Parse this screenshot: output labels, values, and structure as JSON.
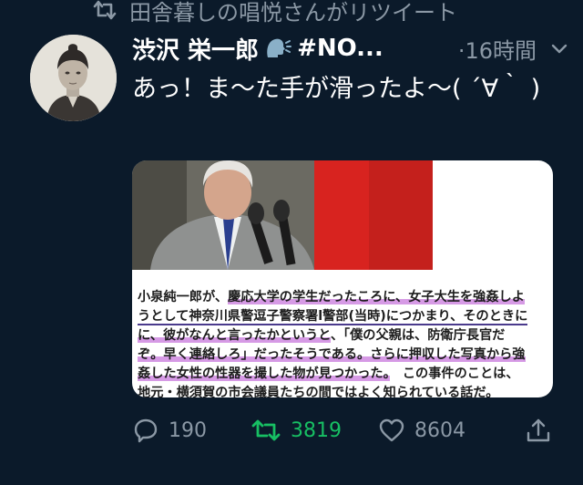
{
  "retweet_banner": {
    "text": "田舎暮しの唱悦さんがリツイート",
    "icon": "retweet-icon"
  },
  "tweet": {
    "author_name": "渋沢 栄一郎",
    "name_emoji": "speaking-head-icon",
    "name_suffix": "#NO...",
    "time": "·16時間",
    "text": "あっ！ま〜た手が滑ったよ〜( ´∀｀ )",
    "media": {
      "caption_lines": [
        {
          "segments": [
            {
              "t": "小泉純一郎が、",
              "style": "plain"
            },
            {
              "t": "慶応大学の学生だったころに、女子大生を強姦しよ",
              "style": "hl"
            }
          ]
        },
        {
          "segments": [
            {
              "t": "うとして神奈川県警逗子警察署l警部(当時)につかまり、そのときに",
              "style": "ul"
            }
          ]
        },
        {
          "segments": [
            {
              "t": "に、彼がなんと言ったかというと",
              "style": "hl"
            },
            {
              "t": "、「僕の父親は、防衛庁長官だ",
              "style": "plain"
            }
          ]
        },
        {
          "segments": [
            {
              "t": "ぞ。早く連絡しろ」だったそうである。さらに押収した写真から強",
              "style": "hl"
            }
          ]
        },
        {
          "segments": [
            {
              "t": "姦した女性の性器を撮した物が見つかった。",
              "style": "hl"
            },
            {
              "t": "　この事件のことは、",
              "style": "plain"
            }
          ]
        },
        {
          "segments": [
            {
              "t": "地元・横須賀の市会議員たちの間ではよく知られている話だ。",
              "style": "plain"
            }
          ]
        }
      ]
    },
    "actions": {
      "reply_count": "190",
      "retweet_count": "3819",
      "like_count": "8604"
    }
  },
  "colors": {
    "background": "#0b1a2a",
    "secondary_text": "#8b98a5",
    "retweet_active": "#17bf63",
    "highlight": "#c878dc"
  }
}
